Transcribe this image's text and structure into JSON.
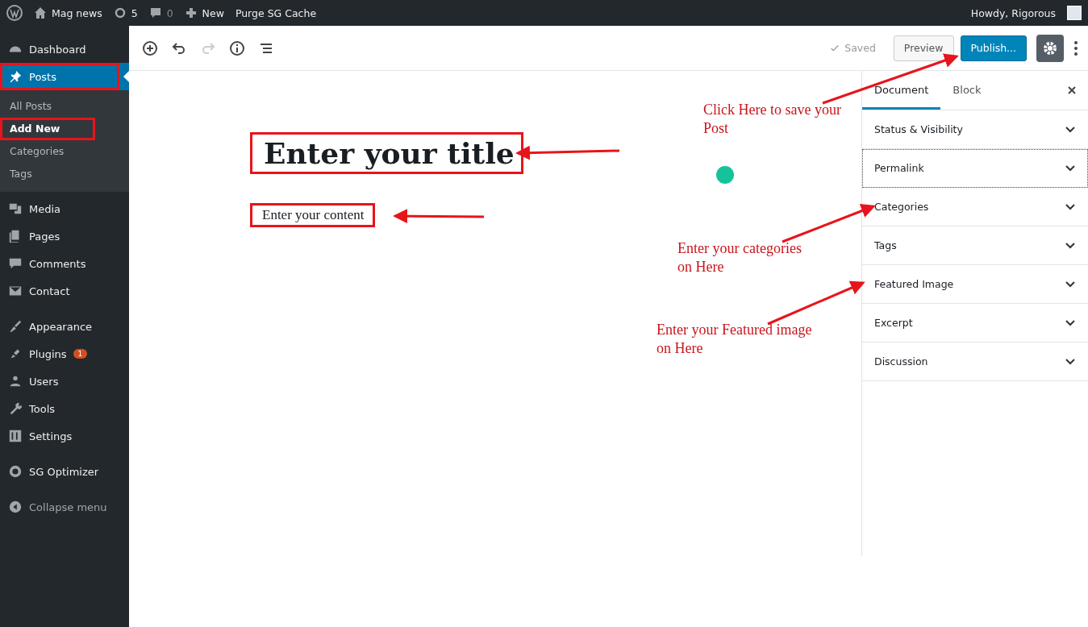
{
  "admin_bar": {
    "site_name": "Mag news",
    "updates_count": "5",
    "comments_count": "0",
    "new_label": "New",
    "purge_label": "Purge SG Cache",
    "greeting": "Howdy, Rigorous"
  },
  "sidebar": {
    "groups": [
      [
        {
          "label": "Dashboard",
          "selected": false,
          "annotated": false
        },
        {
          "label": "Posts",
          "selected": true,
          "annotated": true,
          "children": [
            {
              "label": "All Posts",
              "selected": false,
              "annotated": false
            },
            {
              "label": "Add New",
              "selected": true,
              "annotated": true
            },
            {
              "label": "Categories",
              "selected": false,
              "annotated": false
            },
            {
              "label": "Tags",
              "selected": false,
              "annotated": false
            }
          ]
        },
        {
          "label": "Media",
          "selected": false,
          "annotated": false
        },
        {
          "label": "Pages",
          "selected": false,
          "annotated": false
        },
        {
          "label": "Comments",
          "selected": false,
          "annotated": false
        },
        {
          "label": "Contact",
          "selected": false,
          "annotated": false
        }
      ],
      [
        {
          "label": "Appearance",
          "selected": false,
          "annotated": false
        },
        {
          "label": "Plugins",
          "selected": false,
          "annotated": false,
          "badge": "1"
        },
        {
          "label": "Users",
          "selected": false,
          "annotated": false
        },
        {
          "label": "Tools",
          "selected": false,
          "annotated": false
        },
        {
          "label": "Settings",
          "selected": false,
          "annotated": false
        }
      ],
      [
        {
          "label": "SG Optimizer",
          "selected": false,
          "annotated": false
        }
      ]
    ],
    "collapse_label": "Collapse menu"
  },
  "toolbar": {
    "saved_label": "Saved",
    "preview_label": "Preview",
    "publish_label": "Publish..."
  },
  "editor": {
    "title": "Enter your title",
    "title_annotated": true,
    "content": "Enter your content",
    "content_annotated": true
  },
  "panel": {
    "tabs": [
      {
        "label": "Document",
        "selected": true
      },
      {
        "label": "Block",
        "selected": false
      }
    ],
    "sections": [
      {
        "label": "Status & Visibility",
        "expanded": false,
        "focused": false
      },
      {
        "label": "Permalink",
        "expanded": false,
        "focused": true
      },
      {
        "label": "Categories",
        "expanded": false,
        "focused": false
      },
      {
        "label": "Tags",
        "expanded": false,
        "focused": false
      },
      {
        "label": "Featured Image",
        "expanded": false,
        "focused": false
      },
      {
        "label": "Excerpt",
        "expanded": false,
        "focused": false
      },
      {
        "label": "Discussion",
        "expanded": false,
        "focused": false
      }
    ]
  },
  "annotations": [
    {
      "text": "Click Here to save your Post"
    },
    {
      "text": "Enter your categories on Here"
    },
    {
      "text": "Enter your Featured image on Here"
    }
  ]
}
